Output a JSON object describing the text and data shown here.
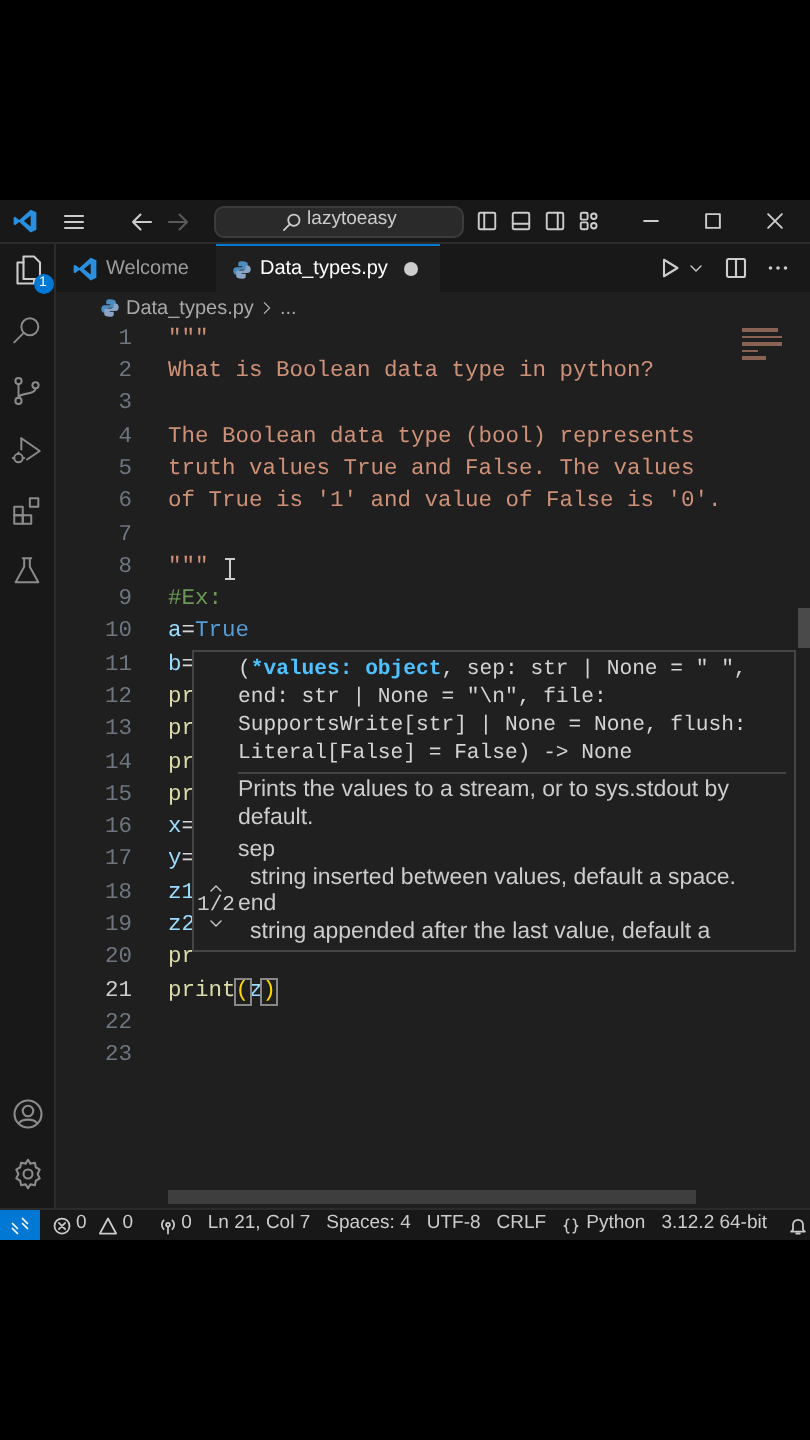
{
  "title_bar": {
    "search": "lazytoeasy",
    "back_enabled": true,
    "forward_enabled": false
  },
  "activity_bar": {
    "items": [
      {
        "kind": "explorer",
        "badge": "1"
      },
      {
        "kind": "search"
      },
      {
        "kind": "source_control"
      },
      {
        "kind": "run_debug"
      },
      {
        "kind": "extensions"
      },
      {
        "kind": "testing"
      }
    ],
    "bottom_items": [
      {
        "kind": "account"
      },
      {
        "kind": "settings"
      }
    ]
  },
  "tabs": [
    {
      "label": "Welcome",
      "kind": "welcome",
      "selected": false,
      "modified": false
    },
    {
      "label": "Data_types.py",
      "kind": "python",
      "selected": true,
      "modified": true
    }
  ],
  "breadcrumb": {
    "file": "Data_types.py",
    "more": "..."
  },
  "editor": {
    "lines": [
      {
        "number": "1",
        "current": false,
        "tokens": [
          {
            "text": "\"\"\"",
            "kind": "string"
          }
        ]
      },
      {
        "number": "2",
        "current": false,
        "tokens": [
          {
            "text": "What is Boolean data type in python?",
            "kind": "string"
          }
        ]
      },
      {
        "number": "3",
        "current": false
      },
      {
        "number": "4",
        "current": false,
        "tokens": [
          {
            "text": "The Boolean data type (bool) represents",
            "kind": "string"
          }
        ]
      },
      {
        "number": "5",
        "current": false,
        "tokens": [
          {
            "text": "truth values True and False. The values",
            "kind": "string"
          }
        ]
      },
      {
        "number": "6",
        "current": false,
        "tokens": [
          {
            "text": "of True is '1' and value of False is '0'.",
            "kind": "string"
          }
        ]
      },
      {
        "number": "7",
        "current": false
      },
      {
        "number": "8",
        "current": false,
        "tokens": [
          {
            "text": "\"\"\"",
            "kind": "string"
          }
        ]
      },
      {
        "number": "9",
        "current": false,
        "tokens": [
          {
            "text": "#Ex:",
            "kind": "comment"
          }
        ]
      },
      {
        "number": "10",
        "current": false,
        "tokens": [
          {
            "text": "a",
            "kind": "variable"
          },
          {
            "text": "=",
            "kind": "operator"
          },
          {
            "text": "True",
            "kind": "keyword"
          }
        ]
      },
      {
        "number": "11",
        "current": false,
        "tokens": [
          {
            "text": "b",
            "kind": "variable"
          },
          {
            "text": "=",
            "kind": "operator"
          }
        ]
      },
      {
        "number": "12",
        "current": false,
        "tokens": [
          {
            "text": "pr",
            "kind": "function"
          }
        ]
      },
      {
        "number": "13",
        "current": false,
        "tokens": [
          {
            "text": "pr",
            "kind": "function"
          }
        ]
      },
      {
        "number": "14",
        "current": false,
        "tokens": [
          {
            "text": "pr",
            "kind": "function"
          }
        ]
      },
      {
        "number": "15",
        "current": false,
        "tokens": [
          {
            "text": "pr",
            "kind": "function"
          }
        ]
      },
      {
        "number": "16",
        "current": false,
        "tokens": [
          {
            "text": "x",
            "kind": "variable"
          },
          {
            "text": "=",
            "kind": "operator"
          }
        ]
      },
      {
        "number": "17",
        "current": false,
        "tokens": [
          {
            "text": "y",
            "kind": "variable"
          },
          {
            "text": "=",
            "kind": "operator"
          }
        ]
      },
      {
        "number": "18",
        "current": false,
        "tokens": [
          {
            "text": "z1",
            "kind": "variable"
          }
        ]
      },
      {
        "number": "19",
        "current": false,
        "tokens": [
          {
            "text": "z2",
            "kind": "variable"
          }
        ]
      },
      {
        "number": "20",
        "current": false,
        "tokens": [
          {
            "text": "pr",
            "kind": "function"
          }
        ]
      },
      {
        "number": "21",
        "current": true,
        "tokens": [
          {
            "text": "print",
            "kind": "function"
          },
          {
            "text": "(",
            "kind": "bracket"
          },
          {
            "text": "z",
            "kind": "variable"
          },
          {
            "text": ")",
            "kind": "bracket"
          }
        ]
      },
      {
        "number": "22",
        "current": false
      },
      {
        "number": "23",
        "current": false
      }
    ]
  },
  "hover": {
    "counter": "1/2",
    "signature": [
      {
        "text": "(",
        "active": false
      },
      {
        "text": "*values: object",
        "active": true
      },
      {
        "text": ", sep: str | None = \" \", end: str | None = \"\\n\", file: SupportsWrite[str] | None = None, flush: Literal[False] = False) -> None",
        "active": false
      }
    ],
    "docs": [
      {
        "text": "Prints the values to a stream, or to sys.stdout by default.",
        "kind": "summary"
      },
      {
        "text": "sep",
        "kind": "param"
      },
      {
        "text": "string inserted between values, default a space.",
        "kind": "desc"
      },
      {
        "text": "end",
        "kind": "param"
      },
      {
        "text": "string appended after the last value, default a",
        "kind": "desc"
      }
    ]
  },
  "status_bar": {
    "items": [
      {
        "kind": "remote"
      },
      {
        "kind": "errors",
        "text": "0"
      },
      {
        "kind": "warnings",
        "text": "0"
      },
      {
        "kind": "ports",
        "text": "0"
      },
      {
        "kind": "text",
        "text": "Ln 21, Col 7"
      },
      {
        "kind": "text",
        "text": "Spaces: 4"
      },
      {
        "kind": "text",
        "text": "UTF-8"
      },
      {
        "kind": "text",
        "text": "CRLF"
      },
      {
        "kind": "language",
        "text": "Python"
      },
      {
        "kind": "text",
        "text": "3.12.2 64-bit"
      },
      {
        "kind": "bell"
      }
    ]
  }
}
